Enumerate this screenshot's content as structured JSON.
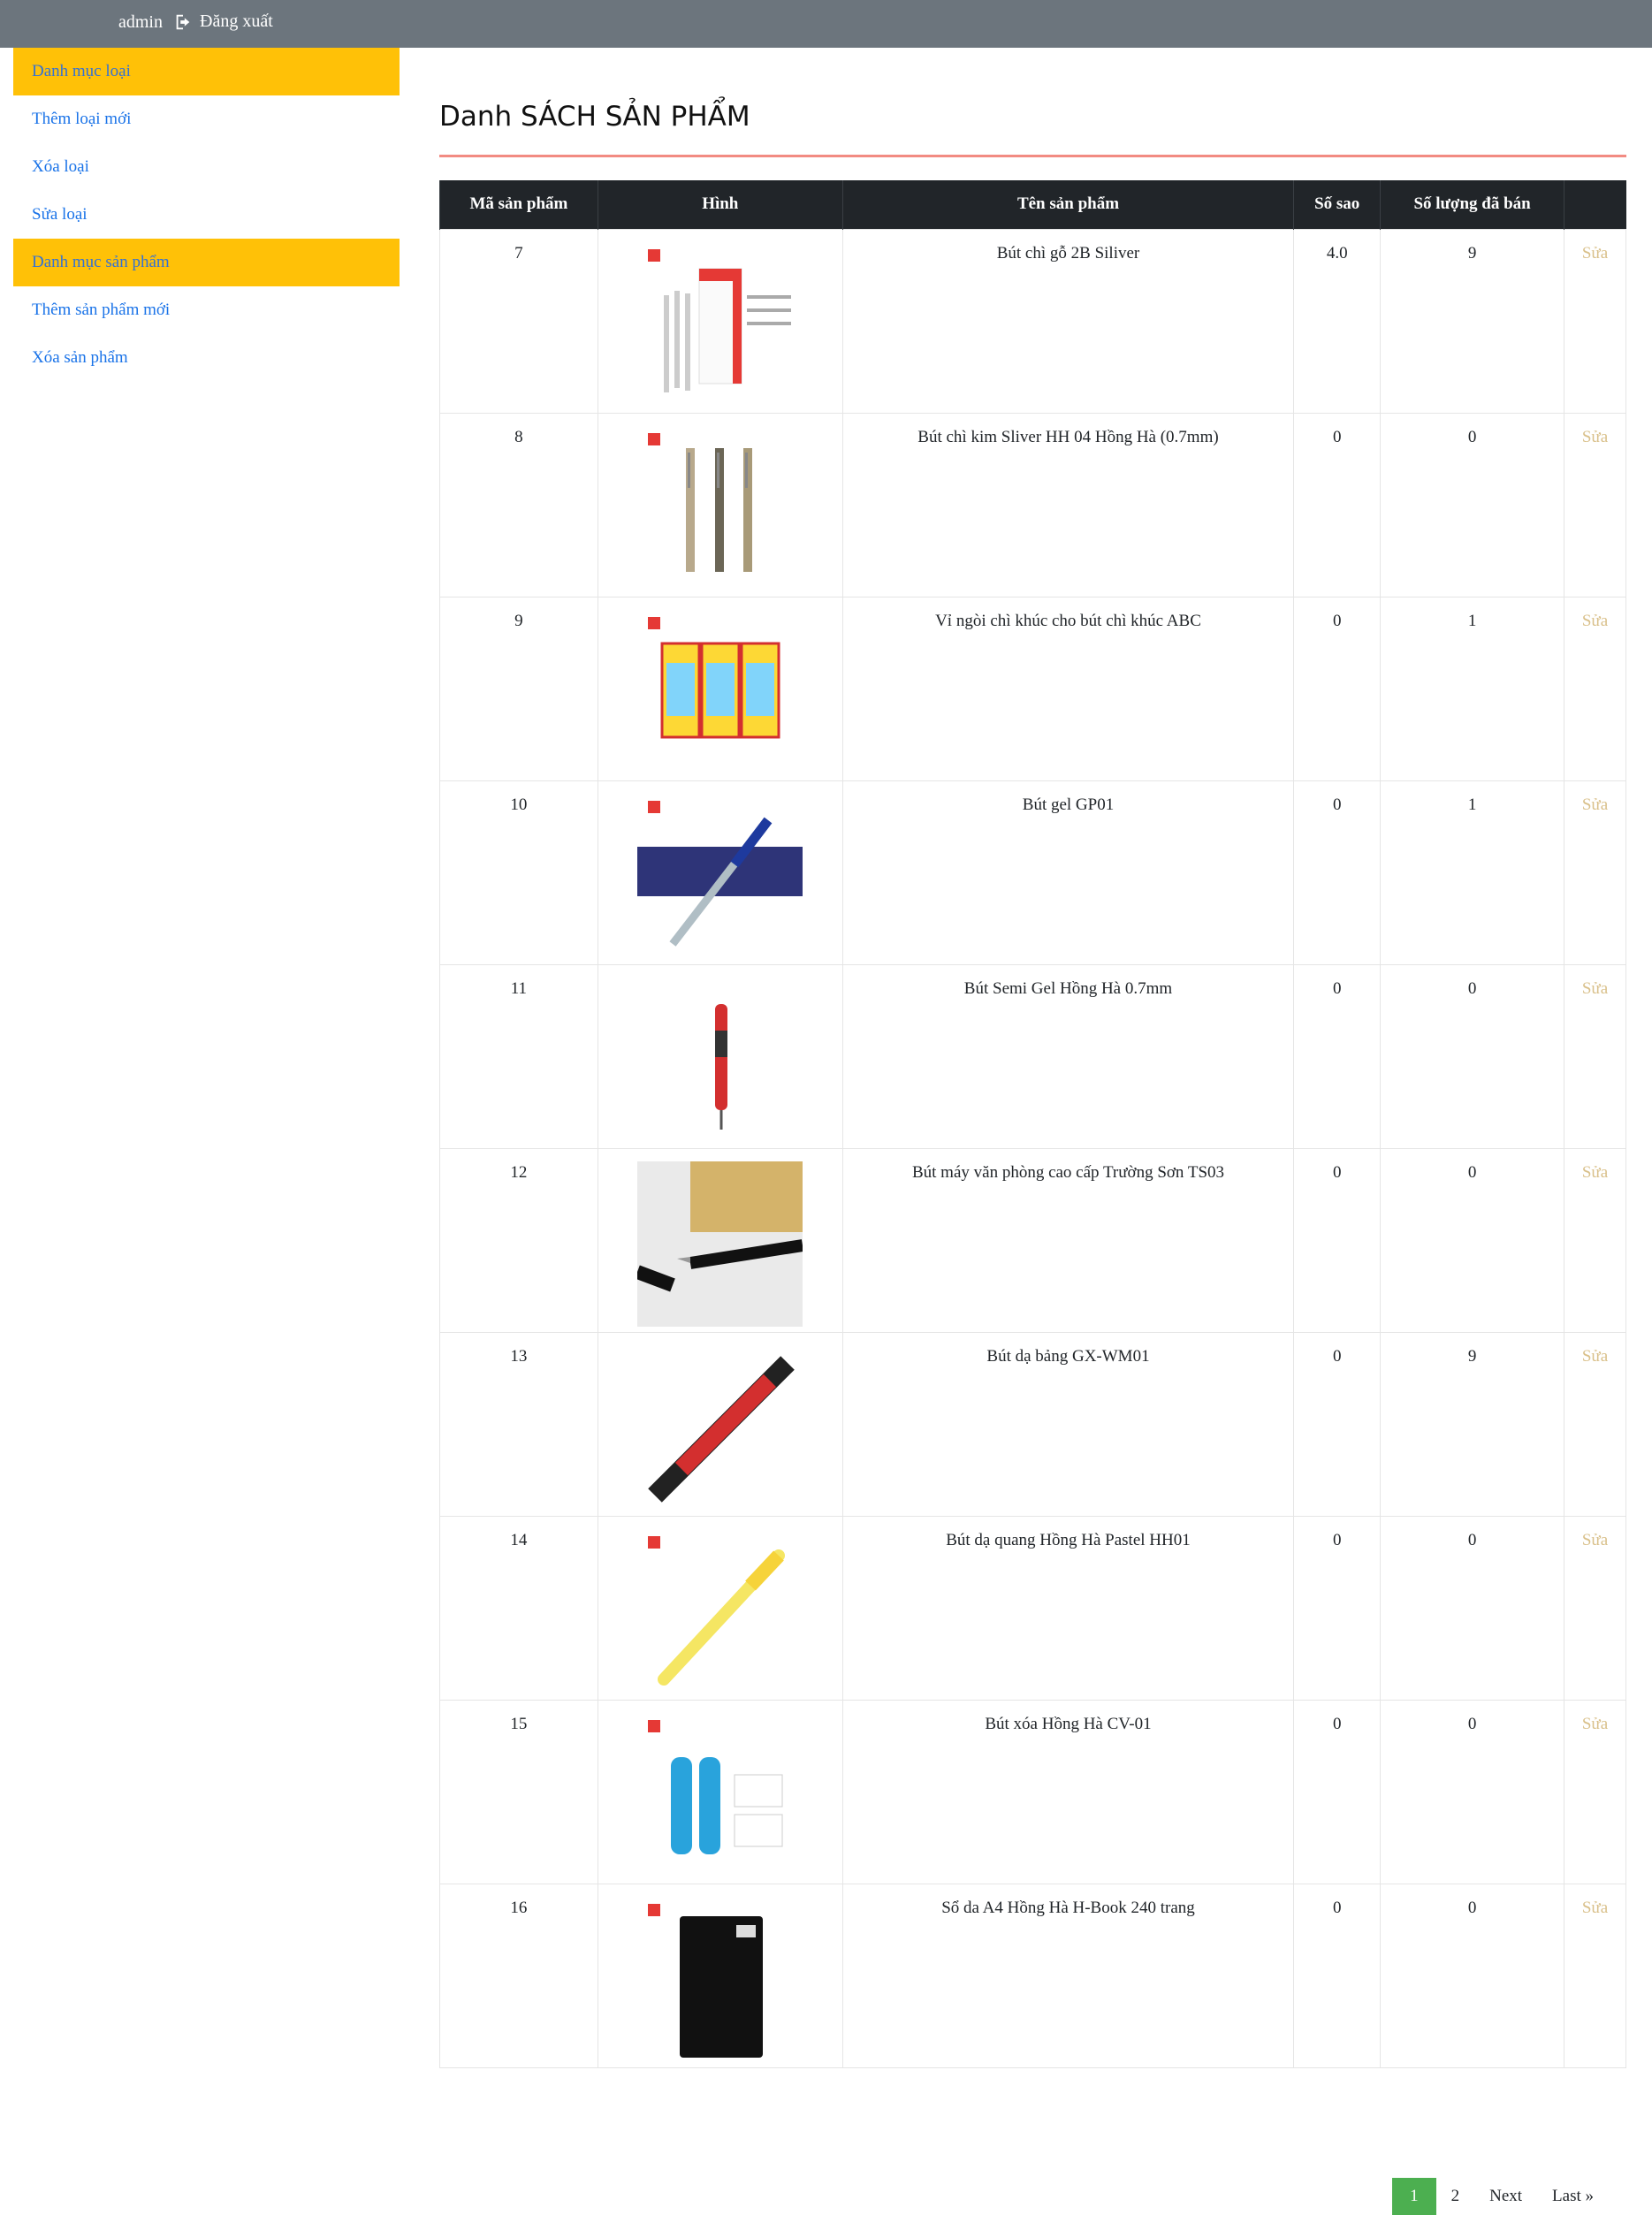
{
  "topbar": {
    "user": "admin",
    "logout_label": "Đăng xuất"
  },
  "sidebar": {
    "items": [
      {
        "label": "Danh mục loại",
        "active": true
      },
      {
        "label": "Thêm loại mới",
        "active": false
      },
      {
        "label": "Xóa loại",
        "active": false
      },
      {
        "label": "Sửa loại",
        "active": false
      },
      {
        "label": "Danh mục sản phẩm",
        "active": true
      },
      {
        "label": "Thêm sản phẩm mới",
        "active": false
      },
      {
        "label": "Xóa sản phẩm",
        "active": false
      }
    ]
  },
  "main": {
    "title": "Danh SÁCH SẢN PHẨM"
  },
  "table": {
    "headers": [
      "Mã sản phẩm",
      "Hình",
      "Tên sản phẩm",
      "Số sao",
      "Số lượng đã bán",
      ""
    ],
    "edit_label": "Sửa",
    "rows": [
      {
        "id": "7",
        "name": "Bút chì gỗ 2B Siliver",
        "stars": "4.0",
        "sold": "9",
        "image": "pencil-box"
      },
      {
        "id": "8",
        "name": "Bút chì kim Sliver HH 04 Hồng Hà (0.7mm)",
        "stars": "0",
        "sold": "0",
        "image": "mechanical-pencils"
      },
      {
        "id": "9",
        "name": "Vỉ ngòi chì khúc cho bút chì khúc ABC",
        "stars": "0",
        "sold": "1",
        "image": "lead-packs"
      },
      {
        "id": "10",
        "name": "Bút gel GP01",
        "stars": "0",
        "sold": "1",
        "image": "blue-gel-pen"
      },
      {
        "id": "11",
        "name": "Bút Semi Gel Hồng Hà 0.7mm",
        "stars": "0",
        "sold": "0",
        "image": "red-pen"
      },
      {
        "id": "12",
        "name": "Bút máy văn phòng cao cấp Trường Sơn TS03",
        "stars": "0",
        "sold": "0",
        "image": "fountain-pen"
      },
      {
        "id": "13",
        "name": "Bút dạ bảng GX-WM01",
        "stars": "0",
        "sold": "9",
        "image": "whiteboard-marker"
      },
      {
        "id": "14",
        "name": "Bút dạ quang Hồng Hà Pastel HH01",
        "stars": "0",
        "sold": "0",
        "image": "highlighter"
      },
      {
        "id": "15",
        "name": "Bút xóa Hồng Hà CV-01",
        "stars": "0",
        "sold": "0",
        "image": "correction-pens"
      },
      {
        "id": "16",
        "name": "Sổ da A4 Hồng Hà H-Book 240 trang",
        "stars": "0",
        "sold": "0",
        "image": "notebook"
      }
    ]
  },
  "pagination": {
    "pages": [
      "1",
      "2"
    ],
    "current": "1",
    "next_label": "Next",
    "last_label": "Last »"
  },
  "colors": {
    "topbar": "#6c757d",
    "sidebar_active": "#ffc107",
    "link": "#1a73e8",
    "header": "#212529",
    "title_rule": "#f28b82",
    "pager_active": "#4caf50",
    "edit": "#d9c08a"
  }
}
